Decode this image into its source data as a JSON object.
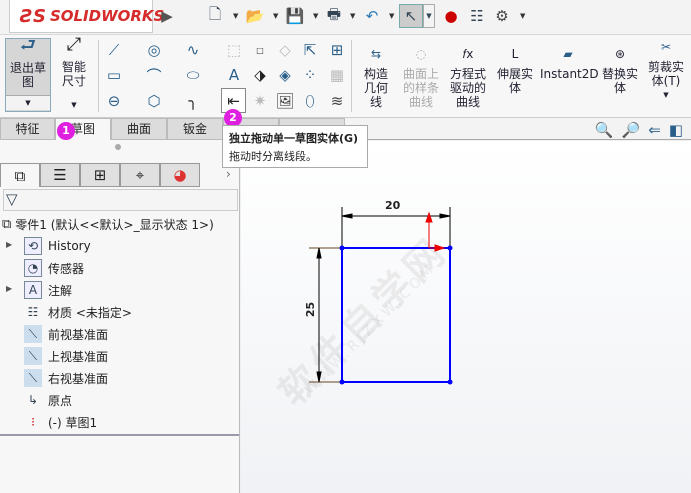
{
  "app": {
    "logo": "SOLIDWORKS"
  },
  "topbar": {
    "icons": [
      "new-document-icon",
      "open-icon",
      "save-icon",
      "print-icon",
      "undo-icon",
      "select-icon",
      "rebuild-icon",
      "file-properties-icon",
      "options-icon"
    ]
  },
  "commands": {
    "exit_sketch": "退出草图",
    "smart_dim": "智能尺寸",
    "construction": "构造几何线",
    "surface_spline": "曲面上的样条曲线",
    "equation_curve": "方程式驱动的曲线",
    "stretch": "伸展实体",
    "instant2d": "Instant2D",
    "replace": "替换实体",
    "trim": "剪裁实体(T)"
  },
  "tabs": [
    "特征",
    "草图",
    "曲面",
    "钣金"
  ],
  "badges": {
    "one": "1",
    "two": "2"
  },
  "tooltip": {
    "title": "独立拖动单一草图实体(G)",
    "desc": "拖动时分离线段。"
  },
  "tree": {
    "root": "零件1  (默认<<默认>_显示状态 1>)",
    "items": [
      "History",
      "传感器",
      "注解",
      "材质 <未指定>",
      "前视基准面",
      "上视基准面",
      "右视基准面",
      "原点",
      "(-) 草图1"
    ]
  },
  "sketch": {
    "width_dim": "20",
    "height_dim": "25",
    "line_color": "#0000ff"
  },
  "watermark": {
    "text": "软件自学网",
    "url": "WWW.RJZXW.COM"
  }
}
